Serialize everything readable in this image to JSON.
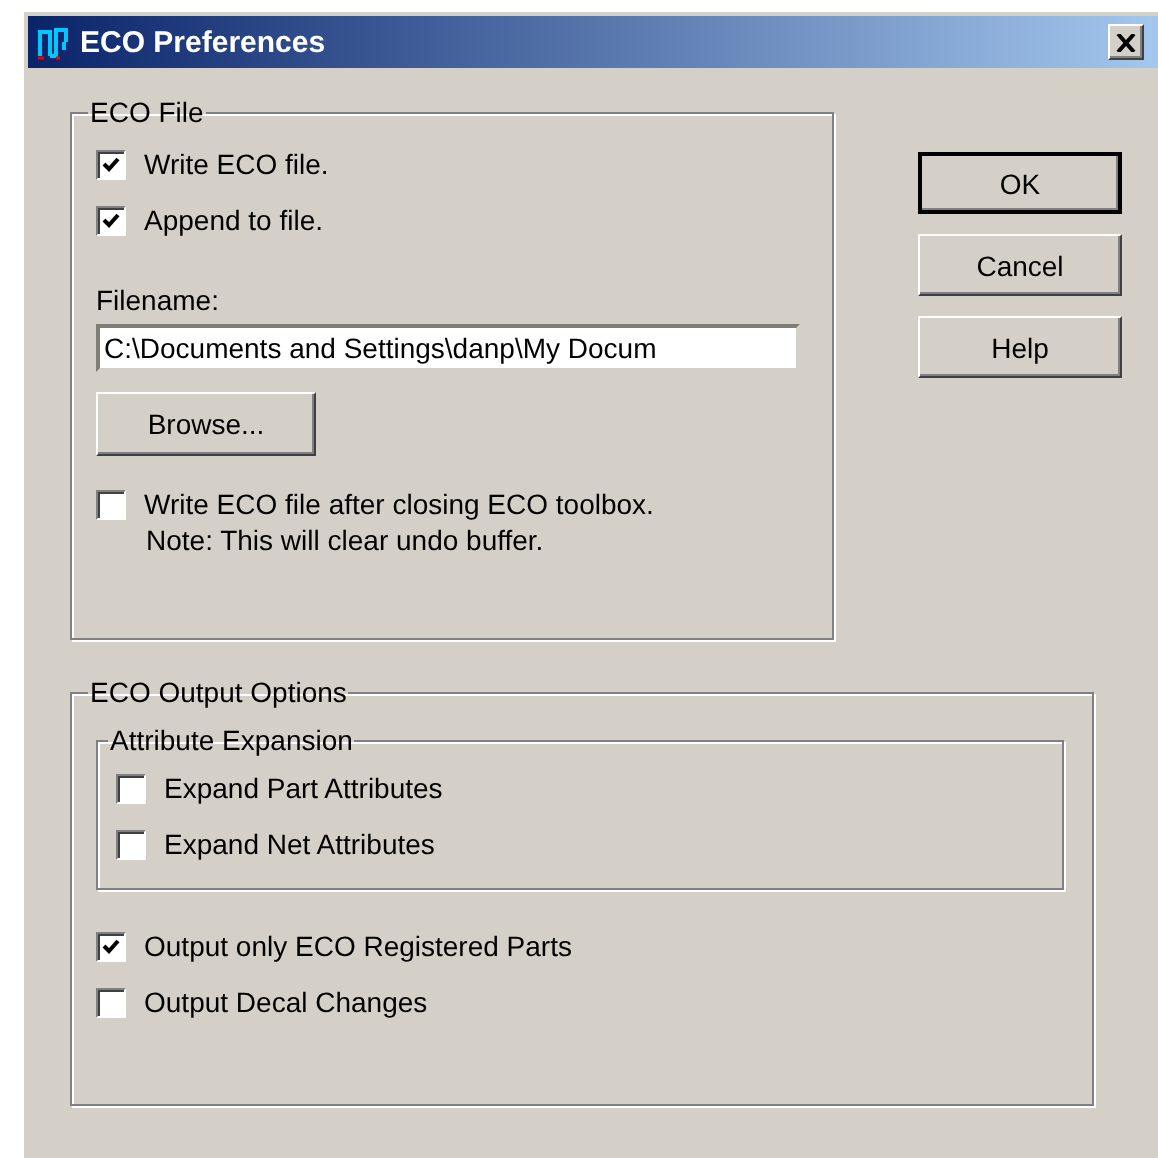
{
  "window": {
    "title": "ECO Preferences"
  },
  "eco_file": {
    "title": "ECO File",
    "options": [
      {
        "label": "Write ECO file.",
        "checked": true
      },
      {
        "label": "Append to file.",
        "checked": true
      }
    ],
    "filename_label": "Filename:",
    "filename_value": "C:\\Documents and Settings\\danp\\My Docum",
    "browse_button": "Browse...",
    "after_close": {
      "label": "Write ECO file after closing ECO toolbox.",
      "checked": false
    },
    "note": "Note: This will clear undo buffer."
  },
  "buttons": [
    "OK",
    "Cancel",
    "Help"
  ],
  "output_options": {
    "title": "ECO Output Options",
    "attribute_expansion": {
      "title": "Attribute Expansion",
      "options": [
        {
          "label": "Expand Part Attributes",
          "checked": false
        },
        {
          "label": "Expand Net Attributes",
          "checked": false
        }
      ]
    },
    "options": [
      {
        "label": "Output only ECO Registered Parts",
        "checked": true
      },
      {
        "label": "Output Decal Changes",
        "checked": false
      }
    ]
  }
}
